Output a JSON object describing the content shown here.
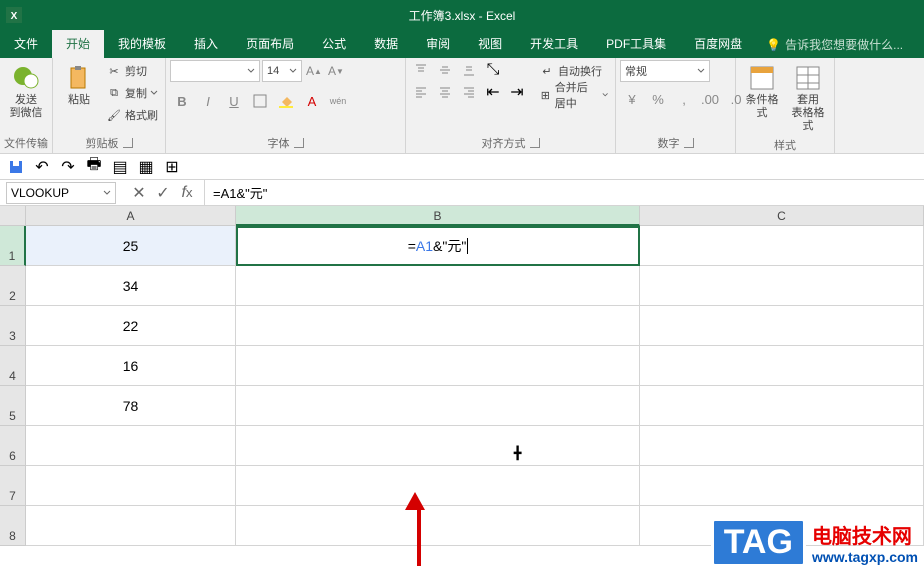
{
  "title": "工作簿3.xlsx - Excel",
  "tabs": [
    "文件",
    "开始",
    "我的模板",
    "插入",
    "页面布局",
    "公式",
    "数据",
    "审阅",
    "视图",
    "开发工具",
    "PDF工具集",
    "百度网盘"
  ],
  "tell_me": "告诉我您想要做什么...",
  "ribbon": {
    "wechat": {
      "l1": "发送",
      "l2": "到微信",
      "group": "文件传输"
    },
    "clipboard": {
      "paste": "粘贴",
      "cut": "剪切",
      "copy": "复制",
      "painter": "格式刷",
      "group": "剪贴板"
    },
    "font": {
      "size": "14",
      "group": "字体",
      "b": "B",
      "i": "I",
      "u": "U"
    },
    "align": {
      "wrap": "自动换行",
      "merge": "合并后居中",
      "group": "对齐方式"
    },
    "number": {
      "format": "常规",
      "group": "数字"
    },
    "styles": {
      "cond": "条件格式",
      "table": "套用\n表格格式",
      "group": "样式"
    }
  },
  "namebox": "VLOOKUP",
  "formula": "=A1&\"元\"",
  "formula_display": {
    "eq": "=",
    "ref": "A1",
    "rest": "&\"元\""
  },
  "cols": [
    "A",
    "B",
    "C"
  ],
  "rows": [
    {
      "n": "1",
      "a": "25"
    },
    {
      "n": "2",
      "a": "34"
    },
    {
      "n": "3",
      "a": "22"
    },
    {
      "n": "4",
      "a": "16"
    },
    {
      "n": "5",
      "a": "78"
    },
    {
      "n": "6",
      "a": ""
    },
    {
      "n": "7",
      "a": ""
    },
    {
      "n": "8",
      "a": ""
    }
  ],
  "watermark": {
    "tag": "TAG",
    "title": "电脑技术网",
    "url": "www.tagxp.com"
  }
}
